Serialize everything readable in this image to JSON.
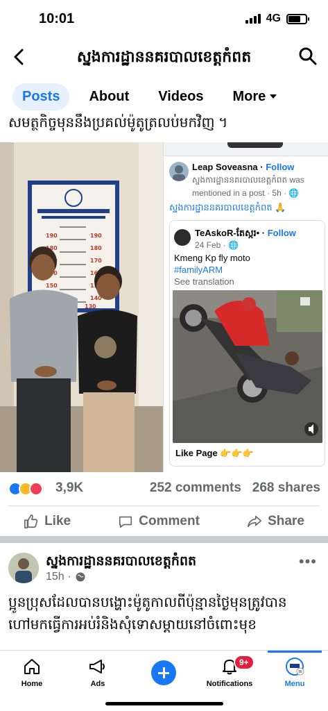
{
  "status_bar": {
    "time": "10:01",
    "network": "4G"
  },
  "nav": {
    "title": "ស្នងការដ្ឋាននគរបាលខេត្តកំពត"
  },
  "tabs": [
    {
      "label": "Posts",
      "active": true
    },
    {
      "label": "About",
      "active": false
    },
    {
      "label": "Videos",
      "active": false
    },
    {
      "label": "More",
      "active": false
    }
  ],
  "post1": {
    "cut_text": "សមត្ថកិច្ចមុននឹងប្រគល់ម៉ូតូត្រលប់មកវិញ ។",
    "photo_chart_labels": [
      "190",
      "180",
      "170",
      "160",
      "150",
      "140",
      "130"
    ],
    "shared": {
      "author": "Leap Soveasna",
      "follow": "Follow",
      "mention": "ស្នងការដ្ឋាននគរបាលខេត្តកំពត was mentioned in a post · 5h · 🌐",
      "caption": "ស្នងការដ្ឋាននគរបាលខេត្តកំពត 🙏",
      "inner": {
        "author": "TeAskoR-តែស្ករ•",
        "follow": "Follow",
        "date": "24 Feb · 🌐",
        "text": "Kmeng Kp fly moto",
        "hashtag": "#familyARM",
        "see_translation": "See translation",
        "like_page": "Like Page 👉👉👉"
      }
    },
    "reactions": {
      "count": "3,9K",
      "comments": "252 comments",
      "shares": "268 shares"
    },
    "actions": {
      "like": "Like",
      "comment": "Comment",
      "share": "Share"
    }
  },
  "post2": {
    "author": "ស្នងការដ្ឋាននគរបាលខេត្តកំពត",
    "time": "15h · ",
    "more": "•••",
    "text": "ប្អូនប្រុសដែលបានបង្ហោះម៉ូតូកាលពីប៉ុន្មានថ្ងៃមុនត្រូវបាន ហៅមកធ្វើការអប់រំនិងសុំទោសម្ដាយនៅចំពោះមុខ"
  },
  "bottom_nav": {
    "home": "Home",
    "ads": "Ads",
    "notifications": "Notifications",
    "notifications_badge": "9+",
    "menu": "Menu"
  },
  "colors": {
    "accent": "#1877f2",
    "badge": "#e41e3f",
    "muted": "#65676b"
  }
}
